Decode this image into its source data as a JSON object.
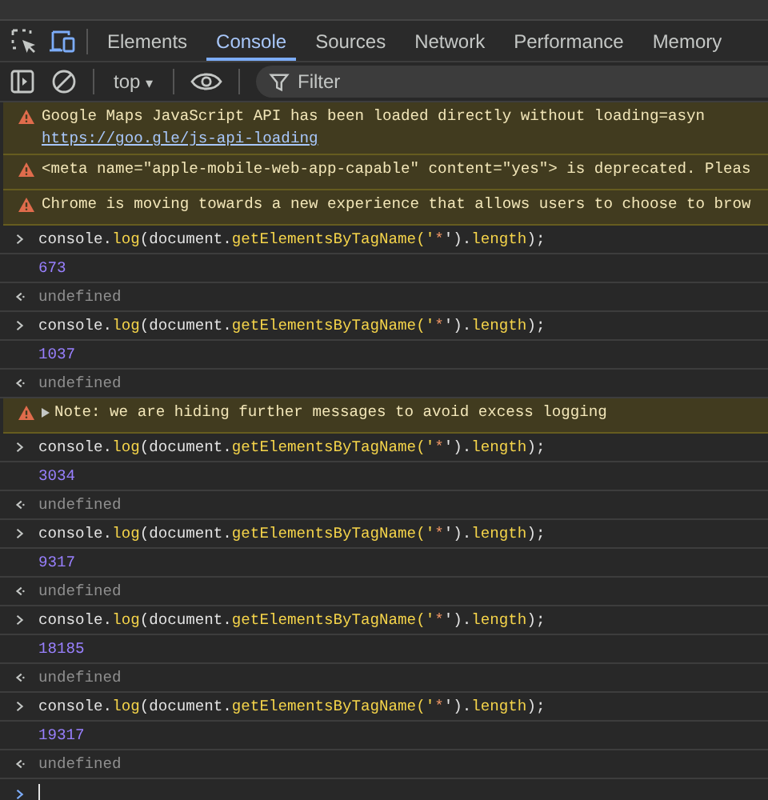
{
  "tabs": [
    {
      "label": "Elements",
      "selected": false
    },
    {
      "label": "Console",
      "selected": true
    },
    {
      "label": "Sources",
      "selected": false
    },
    {
      "label": "Network",
      "selected": false
    },
    {
      "label": "Performance",
      "selected": false
    },
    {
      "label": "Memory",
      "selected": false
    }
  ],
  "toolbar": {
    "context": "top",
    "context_caret": "▾",
    "filter": {
      "placeholder": "Filter"
    }
  },
  "entries": [
    {
      "kind": "warning",
      "text": "Google Maps JavaScript API has been loaded directly without loading=asyn",
      "link": "https://goo.gle/js-api-loading"
    },
    {
      "kind": "warning",
      "text": "<meta name=\"apple-mobile-web-app-capable\" content=\"yes\"> is deprecated. Pleas"
    },
    {
      "kind": "warning",
      "text": "Chrome is moving towards a new experience that allows users to choose to brow"
    },
    {
      "kind": "command",
      "parts": [
        {
          "text": "console.",
          "kind": "plain"
        },
        {
          "text": "log",
          "kind": "method"
        },
        {
          "text": "(document.",
          "kind": "plain"
        },
        {
          "text": "getElementsByTagName",
          "kind": "method"
        },
        {
          "text": "('",
          "kind": "method"
        },
        {
          "text": "*",
          "kind": "string"
        },
        {
          "text": "').",
          "kind": "plain"
        },
        {
          "text": "length",
          "kind": "method"
        },
        {
          "text": ");",
          "kind": "plain"
        }
      ]
    },
    {
      "kind": "result",
      "text": "673"
    },
    {
      "kind": "return",
      "text": "undefined"
    },
    {
      "kind": "command",
      "parts": [
        {
          "text": "console.",
          "kind": "plain"
        },
        {
          "text": "log",
          "kind": "method"
        },
        {
          "text": "(document.",
          "kind": "plain"
        },
        {
          "text": "getElementsByTagName",
          "kind": "method"
        },
        {
          "text": "('",
          "kind": "method"
        },
        {
          "text": "*",
          "kind": "string"
        },
        {
          "text": "').",
          "kind": "plain"
        },
        {
          "text": "length",
          "kind": "method"
        },
        {
          "text": ");",
          "kind": "plain"
        }
      ]
    },
    {
      "kind": "result",
      "text": "1037"
    },
    {
      "kind": "return",
      "text": "undefined"
    },
    {
      "kind": "note",
      "text": "Note: we are hiding further messages to avoid excess logging",
      "expanded": false
    },
    {
      "kind": "command",
      "parts": [
        {
          "text": "console.",
          "kind": "plain"
        },
        {
          "text": "log",
          "kind": "method"
        },
        {
          "text": "(document.",
          "kind": "plain"
        },
        {
          "text": "getElementsByTagName",
          "kind": "method"
        },
        {
          "text": "('",
          "kind": "method"
        },
        {
          "text": "*",
          "kind": "string"
        },
        {
          "text": "').",
          "kind": "plain"
        },
        {
          "text": "length",
          "kind": "method"
        },
        {
          "text": ");",
          "kind": "plain"
        }
      ]
    },
    {
      "kind": "result",
      "text": "3034"
    },
    {
      "kind": "return",
      "text": "undefined"
    },
    {
      "kind": "command",
      "parts": [
        {
          "text": "console.",
          "kind": "plain"
        },
        {
          "text": "log",
          "kind": "method"
        },
        {
          "text": "(document.",
          "kind": "plain"
        },
        {
          "text": "getElementsByTagName",
          "kind": "method"
        },
        {
          "text": "('",
          "kind": "method"
        },
        {
          "text": "*",
          "kind": "string"
        },
        {
          "text": "').",
          "kind": "plain"
        },
        {
          "text": "length",
          "kind": "method"
        },
        {
          "text": ");",
          "kind": "plain"
        }
      ]
    },
    {
      "kind": "result",
      "text": "9317"
    },
    {
      "kind": "return",
      "text": "undefined"
    },
    {
      "kind": "command",
      "parts": [
        {
          "text": "console.",
          "kind": "plain"
        },
        {
          "text": "log",
          "kind": "method"
        },
        {
          "text": "(document.",
          "kind": "plain"
        },
        {
          "text": "getElementsByTagName",
          "kind": "method"
        },
        {
          "text": "('",
          "kind": "method"
        },
        {
          "text": "*",
          "kind": "string"
        },
        {
          "text": "').",
          "kind": "plain"
        },
        {
          "text": "length",
          "kind": "method"
        },
        {
          "text": ");",
          "kind": "plain"
        }
      ]
    },
    {
      "kind": "result",
      "text": "18185"
    },
    {
      "kind": "return",
      "text": "undefined"
    },
    {
      "kind": "command",
      "parts": [
        {
          "text": "console.",
          "kind": "plain"
        },
        {
          "text": "log",
          "kind": "method"
        },
        {
          "text": "(document.",
          "kind": "plain"
        },
        {
          "text": "getElementsByTagName",
          "kind": "method"
        },
        {
          "text": "('",
          "kind": "method"
        },
        {
          "text": "*",
          "kind": "string"
        },
        {
          "text": "').",
          "kind": "plain"
        },
        {
          "text": "length",
          "kind": "method"
        },
        {
          "text": ");",
          "kind": "plain"
        }
      ]
    },
    {
      "kind": "result",
      "text": "19317"
    },
    {
      "kind": "return",
      "text": "undefined"
    }
  ]
}
